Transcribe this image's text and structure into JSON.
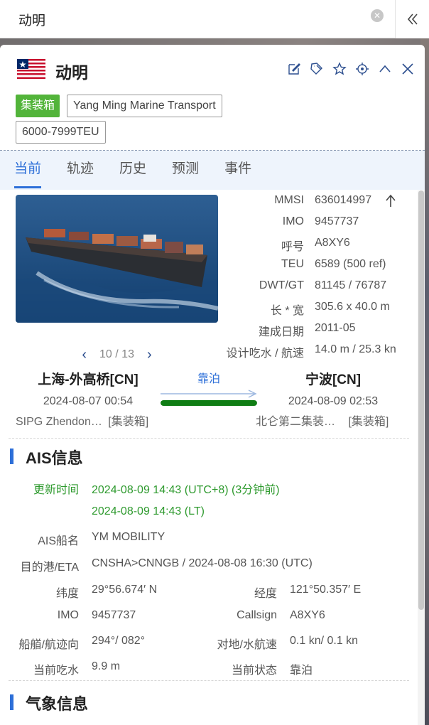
{
  "search": {
    "value": "动明"
  },
  "header": {
    "ship_name": "动明",
    "tags": {
      "type": "集装箱",
      "company": "Yang Ming Marine Transport",
      "capacity": "6000-7999TEU"
    }
  },
  "tabs": [
    {
      "label": "当前"
    },
    {
      "label": "轨迹"
    },
    {
      "label": "历史"
    },
    {
      "label": "预测"
    },
    {
      "label": "事件"
    }
  ],
  "photo": {
    "counter": "10 / 13"
  },
  "specs": [
    {
      "label": "MMSI",
      "value": "636014997"
    },
    {
      "label": "IMO",
      "value": "9457737"
    },
    {
      "label": "呼号",
      "value": "A8XY6"
    },
    {
      "label": "TEU",
      "value": "6589 (500 ref)"
    },
    {
      "label": "DWT/GT",
      "value": "81145 / 76787"
    },
    {
      "label": "长 * 宽",
      "value": "305.6 x 40.0 m"
    },
    {
      "label": "建成日期",
      "value": "2011-05"
    },
    {
      "label": "设计吃水 / 航速",
      "value": "14.0 m / 25.3 kn"
    }
  ],
  "route": {
    "origin": {
      "name": "上海-外高桥[CN]",
      "time": "2024-08-07 00:54",
      "terminal": "SIPG Zhendon…",
      "terminal_type": "[集装箱]"
    },
    "destination": {
      "name": "宁波[CN]",
      "time": "2024-08-09 02:53",
      "terminal": "北仑第二集装…",
      "terminal_type": "[集装箱]"
    },
    "status": "靠泊",
    "progress": 1.0
  },
  "ais": {
    "title": "AIS信息",
    "update_label": "更新时间",
    "update_utc": "2024-08-09 14:43 (UTC+8) (3分钟前)",
    "update_lt": "2024-08-09 14:43 (LT)",
    "ship_name_label": "AIS船名",
    "ship_name": "YM MOBILITY",
    "dest_label": "目的港/ETA",
    "dest": "CNSHA>CNNGB / 2024-08-08 16:30 (UTC)",
    "lat_label": "纬度",
    "lat": "29°56.674′ N",
    "lon_label": "经度",
    "lon": "121°50.357′ E",
    "imo_label": "IMO",
    "imo": "9457737",
    "callsign_label": "Callsign",
    "callsign": "A8XY6",
    "heading_label": "船艏/航迹向",
    "heading": "294°/ 082°",
    "speed_label": "对地/水航速",
    "speed": "0.1 kn/ 0.1 kn",
    "draft_label": "当前吃水",
    "draft": "9.9 m",
    "status_label": "当前状态",
    "status": "靠泊"
  },
  "weather": {
    "title": "气象信息"
  },
  "colors": {
    "accent": "#2d6fd8",
    "tag_green": "#52b43a",
    "progress": "#0f7d14",
    "update_green": "#2e9a2e"
  }
}
